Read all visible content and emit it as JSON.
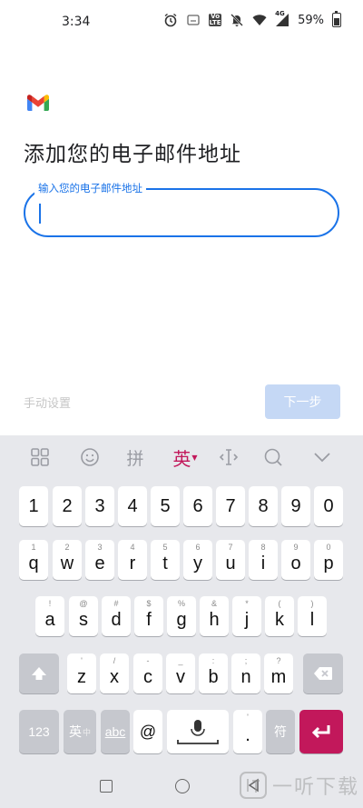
{
  "status_bar": {
    "time": "3:34",
    "battery": "59%",
    "network": "4G",
    "volte_label": "Vo LTE",
    "icons": [
      "alarm-icon",
      "cast-icon",
      "volte-icon",
      "mute-icon",
      "wifi-icon",
      "signal-icon",
      "battery-icon"
    ]
  },
  "screen": {
    "title": "添加您的电子邮件地址",
    "email_field": {
      "label": "输入您的电子邮件地址",
      "value": "",
      "placeholder": ""
    },
    "manual_setup_label": "手动设置",
    "next_button_label": "下一步"
  },
  "colors": {
    "accent": "#1a73e8",
    "next_button_disabled": "#c5d8f5",
    "keyboard_bg": "#e7e8ec",
    "enter_key": "#c2185b"
  },
  "keyboard": {
    "toolbar": {
      "pinyin_label": "拼",
      "language_label": "英",
      "icons": [
        "grid-icon",
        "emoji-icon",
        "pinyin-icon",
        "language-icon",
        "cursor-icon",
        "search-icon",
        "collapse-icon"
      ]
    },
    "number_row": [
      "1",
      "2",
      "3",
      "4",
      "5",
      "6",
      "7",
      "8",
      "9",
      "0"
    ],
    "row1": {
      "keys": [
        "q",
        "w",
        "e",
        "r",
        "t",
        "y",
        "u",
        "i",
        "o",
        "p"
      ],
      "hints": [
        "1",
        "2",
        "3",
        "4",
        "5",
        "6",
        "7",
        "8",
        "9",
        "0"
      ]
    },
    "row2": {
      "keys": [
        "a",
        "s",
        "d",
        "f",
        "g",
        "h",
        "j",
        "k",
        "l"
      ],
      "hints": [
        "!",
        "@",
        "#",
        "$",
        "%",
        "&",
        "*",
        "(",
        ")"
      ]
    },
    "row3": {
      "keys": [
        "z",
        "x",
        "c",
        "v",
        "b",
        "n",
        "m"
      ],
      "hints": [
        "'",
        "/",
        "-",
        "_",
        ":",
        ";",
        "?"
      ]
    },
    "bottom_row": {
      "numbers_label": "123",
      "lang_label": "英",
      "lang_sub": "中",
      "abc_label": "abc",
      "at_label": "@",
      "dot_label": ".",
      "dot_hint": "'",
      "symbols_label": "符"
    }
  },
  "watermark": {
    "text": "一听下载"
  }
}
